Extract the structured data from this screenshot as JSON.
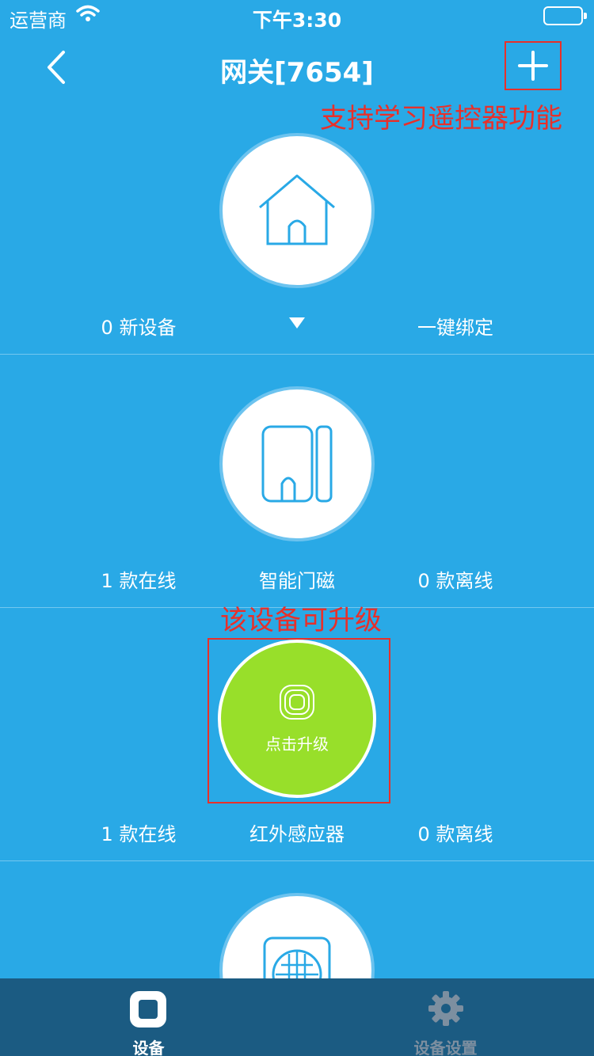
{
  "status_bar": {
    "carrier": "运营商",
    "time": "下午3:30"
  },
  "nav": {
    "title": "网关[7654]"
  },
  "annotations": {
    "add_note": "支持学习遥控器功能",
    "upgrade_note": "该设备可升级"
  },
  "gateway": {
    "left": "0 新设备",
    "right": "一键绑定"
  },
  "door_sensor": {
    "left": "1 款在线",
    "name": "智能门磁",
    "right": "0 款离线"
  },
  "ir_sensor": {
    "left": "1 款在线",
    "name": "红外感应器",
    "right": "0 款离线",
    "upgrade_label": "点击升级"
  },
  "tabbar": {
    "devices": "设备",
    "settings": "设备设置"
  },
  "colors": {
    "background": "#29a9e6",
    "annotation": "#e8302a",
    "upgrade": "#98df2a",
    "tabbar": "#1b5b82"
  }
}
